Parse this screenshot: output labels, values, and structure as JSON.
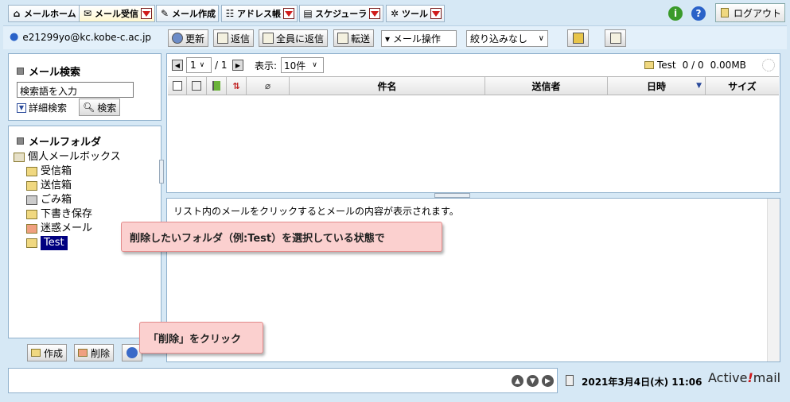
{
  "tabs": [
    {
      "label": "メールホーム",
      "icon": "home-icon",
      "has_dropdown": false
    },
    {
      "label": "メール受信",
      "icon": "inbox-icon",
      "has_dropdown": true,
      "active": true
    },
    {
      "label": "メール作成",
      "icon": "compose-icon",
      "has_dropdown": false
    },
    {
      "label": "アドレス帳",
      "icon": "addressbook-icon",
      "has_dropdown": true
    },
    {
      "label": "スケジューラ",
      "icon": "calendar-icon",
      "has_dropdown": true
    },
    {
      "label": "ツール",
      "icon": "gear-icon",
      "has_dropdown": true
    }
  ],
  "header": {
    "logout_label": "ログアウト",
    "info_icon_glyph": "i",
    "help_icon_glyph": "?"
  },
  "toolbar": {
    "user_email": "e21299yo@kc.kobe-c.ac.jp",
    "refresh_label": "更新",
    "reply_label": "返信",
    "reply_all_label": "全員に返信",
    "forward_label": "転送",
    "mail_ops_label": "▾ メール操作",
    "filter_label": "絞り込みなし"
  },
  "search": {
    "title": "メール検索",
    "placeholder": "検索語を入力",
    "advanced_label": "詳細検索",
    "search_button": "検索"
  },
  "folders": {
    "title": "メールフォルダ",
    "root": "個人メールボックス",
    "items": [
      "受信箱",
      "送信箱",
      "ごみ箱",
      "下書き保存",
      "迷惑メール",
      "Test"
    ],
    "selected": "Test"
  },
  "folder_actions": {
    "create_label": "作成",
    "delete_label": "削除"
  },
  "list": {
    "page_current": "1",
    "page_total": "/ 1",
    "display_label": "表示:",
    "per_page": "10件",
    "folder_name": "Test",
    "counts": "0 / 0",
    "size": "0.00MB",
    "columns": {
      "subject": "件名",
      "sender": "送信者",
      "date": "日時",
      "size": "サイズ"
    }
  },
  "preview": {
    "hint": "リスト内のメールをクリックするとメールの内容が表示されます。"
  },
  "annotations": {
    "callout_folder": "削除したいフォルダ（例:Test）を選択している状態で",
    "callout_delete": "「削除」をクリック"
  },
  "status_bar": {
    "datetime": "2021年3月4日(木) 11:06",
    "brand_active": "Active",
    "brand_bang": "!",
    "brand_mail": "mail"
  },
  "colors": {
    "background": "#d6e8f5",
    "selected_folder": "#000080",
    "callout_fill": "#fbd0cf",
    "brand_red": "#d0191b"
  }
}
